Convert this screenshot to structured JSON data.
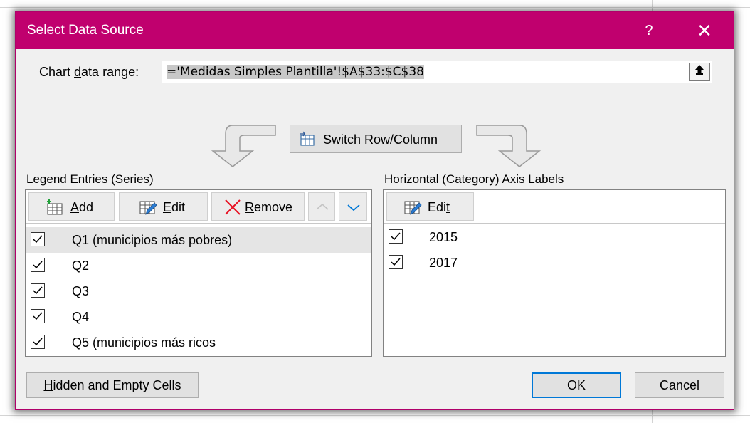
{
  "dialog": {
    "title": "Select Data Source",
    "help_label": "?",
    "close_label": "✕"
  },
  "range": {
    "label_pre": "Chart ",
    "label_accel": "d",
    "label_post": "ata range:",
    "value": "='Medidas Simples Plantilla'!$A$33:$C$38",
    "collapse_icon": "collapse-up-icon"
  },
  "switch_button": {
    "accel_pre": "S",
    "accel": "w",
    "label_post": "itch Row/Column"
  },
  "legend": {
    "title_pre": "Legend Entries (",
    "title_accel": "S",
    "title_post": "eries)",
    "add": {
      "accel": "A",
      "rest": "dd"
    },
    "edit": {
      "accel": "E",
      "rest": "dit"
    },
    "remove": {
      "accel": "R",
      "rest": "emove"
    },
    "items": [
      {
        "label": "Q1 (municipios más pobres)",
        "checked": true,
        "selected": true
      },
      {
        "label": "Q2",
        "checked": true,
        "selected": false
      },
      {
        "label": "Q3",
        "checked": true,
        "selected": false
      },
      {
        "label": "Q4",
        "checked": true,
        "selected": false
      },
      {
        "label": "Q5 (municipios más ricos",
        "checked": true,
        "selected": false
      }
    ]
  },
  "axis": {
    "title_pre": "Horizontal (",
    "title_accel": "C",
    "title_post": "ategory) Axis Labels",
    "edit": {
      "pre": "Edi",
      "accel": "t"
    },
    "items": [
      {
        "label": "2015",
        "checked": true
      },
      {
        "label": "2017",
        "checked": true
      }
    ]
  },
  "footer": {
    "hidden": {
      "accel": "H",
      "rest": "idden and Empty Cells"
    },
    "ok": "OK",
    "cancel": "Cancel"
  },
  "colors": {
    "titlebar": "#c0006e",
    "focus": "#0078d7",
    "remove_icon": "#e81123",
    "down_arrow": "#0078d7"
  }
}
